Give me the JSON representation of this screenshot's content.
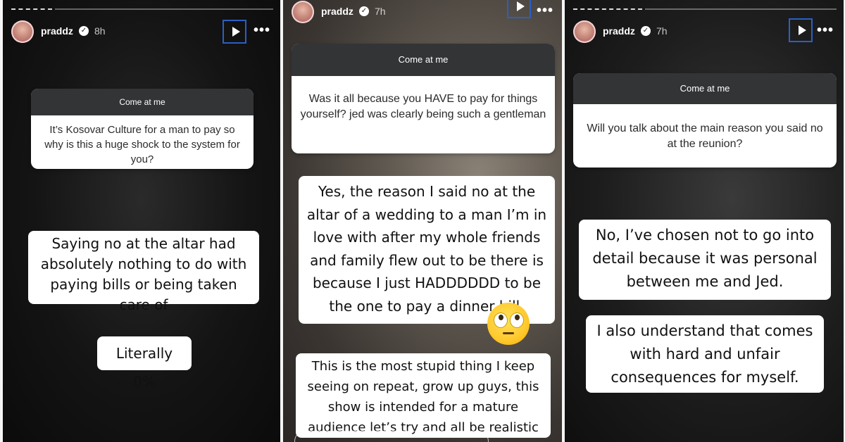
{
  "panels": [
    {
      "username": "praddz",
      "time": "8h",
      "question": {
        "header": "Come at me",
        "text": "It’s Kosovar Culture for a man to pay so why is this a huge shock to the system for you?"
      },
      "stickers": [
        "Saying no at the altar had absolutely nothing to do with paying bills or being taken care of",
        "Literally 0%"
      ]
    },
    {
      "username": "praddz",
      "time": "7h",
      "question": {
        "header": "Come at me",
        "text": "Was it all because you HAVE to pay for things yourself? jed was clearly being such a gentleman"
      },
      "stickers": [
        "Yes, the reason I said no at the altar of a wedding to a man I’m in love with after my whole friends and family flew out to be there is because I just HADDDDDD to be the one to pay a dinner bill.",
        "This is the most stupid thing I keep seeing on repeat, grow up guys, this show is intended for a mature audience let’s try and all be realistic now"
      ],
      "emoji": "eye-roll-emoji"
    },
    {
      "username": "praddz",
      "time": "7h",
      "question": {
        "header": "Come at me",
        "text": "Will you talk about the main reason you said no at the reunion?"
      },
      "stickers": [
        "No, I’ve chosen not to go into detail because it was personal between me and Jed.",
        "I also understand that comes with hard and unfair consequences for myself."
      ]
    }
  ],
  "icons": {
    "verified": "verified-badge-icon",
    "play": "play-icon",
    "more": "more-options-icon"
  },
  "colors": {
    "play_highlight": "#2b5fc4",
    "question_header_bg": "#333436"
  }
}
